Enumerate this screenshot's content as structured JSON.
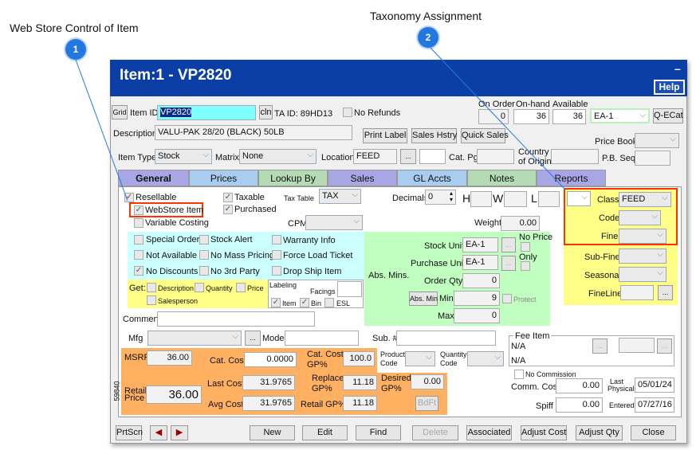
{
  "callouts": [
    {
      "number": "1",
      "text": "Web Store Control of Item"
    },
    {
      "number": "2",
      "text": "Taxonomy Assignment"
    }
  ],
  "window": {
    "title": "Item:1 - VP2820",
    "minimize": "–",
    "help": "Help"
  },
  "top": {
    "grid": "Grid",
    "item_id_label": "Item ID",
    "item_id": "VP2820",
    "cln": "cln",
    "ta_id": "TA ID: 89HD13",
    "no_refunds": "No Refunds",
    "on_order_label": "On Order",
    "on_order": "0",
    "on_hand_label": "On-hand",
    "on_hand": "36",
    "available_label": "Available",
    "available": "36",
    "unit": "EA-1",
    "qecat": "Q-ECat",
    "description_label": "Description",
    "description": "VALU-PAK 28/20 (BLACK) 50LB",
    "print_label": "Print Label",
    "sales_history": "Sales Hstry",
    "quick_sales": "Quick Sales",
    "price_book_label": "Price Book",
    "item_type_label": "Item Type",
    "item_type": "Stock",
    "matrix_label": "Matrix",
    "matrix": "None",
    "location_label": "Location",
    "location": "FEED",
    "more": "...",
    "cat_pg_label": "Cat. Pg.",
    "country_label_1": "Country",
    "country_label_2": "of Origin",
    "pb_seq_label": "P.B. Seq."
  },
  "tabs": [
    {
      "label": "General",
      "color": "#a9a6e6"
    },
    {
      "label": "Prices",
      "color": "#a8cdf0"
    },
    {
      "label": "Lookup By",
      "color": "#b5dbb5"
    },
    {
      "label": "Sales",
      "color": "#a9a6e6"
    },
    {
      "label": "GL Accts",
      "color": "#a8cdf0"
    },
    {
      "label": "Notes",
      "color": "#b5dbb5"
    },
    {
      "label": "Reports",
      "color": "#a9a6e6"
    }
  ],
  "general": {
    "resellable": "Resellable",
    "webstore": "WebStore Item",
    "variable_costing": "Variable Costing",
    "taxable": "Taxable",
    "purchased": "Purchased",
    "tax_table_label": "Tax Table",
    "tax_table": "TAX",
    "cpm_label": "CPM",
    "decimals_label": "Decimals",
    "decimals": "0",
    "h": "H",
    "w": "W",
    "l": "L",
    "weight_label": "Weight",
    "weight": "0.00",
    "flags": [
      [
        "Special Order",
        "Stock Alert",
        "Warranty Info"
      ],
      [
        "Not Available",
        "No Mass Pricing",
        "Force Load Ticket"
      ],
      [
        "No Discounts",
        "No 3rd Party",
        "Drop Ship Item"
      ]
    ],
    "get_label": "Get:",
    "get_description": "Description",
    "get_quantity": "Quantity",
    "get_price": "Price",
    "get_salesperson": "Salesperson",
    "labeling": "Labeling",
    "facings": "Facings",
    "label_item": "Item",
    "label_bin": "Bin",
    "label_esl": "ESL",
    "stock_unit_label": "Stock Unit",
    "stock_unit": "EA-1",
    "purchase_unit_label": "Purchase Unit",
    "purchase_unit": "EA-1",
    "no_price": "No Price",
    "only": "Only",
    "abs_mins": "Abs. Mins.",
    "order_qty_label": "Order Qty",
    "order_qty": "0",
    "abs_min_btn": "Abs. Min",
    "min_label": "Min",
    "min": "9",
    "protect": "Protect",
    "max_label": "Max",
    "max": "0",
    "class_label": "Class",
    "class": "FEED",
    "code_label": "Code",
    "fine_label": "Fine",
    "subfine_label": "Sub-Fine",
    "seasonal_label": "Seasonal",
    "fineline_label": "FineLine",
    "comment_label": "Comment",
    "mfg_label": "Mfg",
    "model_label": "Model",
    "sub_label": "Sub. #",
    "msrp_label": "MSRP",
    "msrp": "36.00",
    "cat_cost_label": "Cat. Cost",
    "cat_cost": "0.0000",
    "cat_cost_gp_label_1": "Cat. Cost",
    "cat_cost_gp_label_2": "GP%",
    "cat_cost_gp": "100.0",
    "product_code_1": "Product",
    "product_code_2": "Code",
    "quantity_code_1": "Quantity",
    "quantity_code_2": "Code",
    "retail_price_label_1": "Retail",
    "retail_price_label_2": "Price",
    "retail_price": "36.00",
    "last_cost_label": "Last Cost",
    "last_cost": "31.9765",
    "replace_gp_label_1": "Replace",
    "replace_gp_label_2": "GP%",
    "replace_gp": "11.18",
    "desired_gp_label_1": "Desired",
    "desired_gp_label_2": "GP%",
    "desired_gp": "0.00",
    "avg_cost_label": "Avg Cost",
    "avg_cost": "31.9765",
    "retail_gp_label": "Retail GP%",
    "retail_gp": "11.18",
    "bdft": "BdFt",
    "fee_item_label": "Fee Item",
    "fee_1": "N/A",
    "fee_2": "N/A",
    "no_commission": "No Commission",
    "comm_cost_label": "Comm. Cost",
    "comm_cost": "0.00",
    "last_physical_1": "Last",
    "last_physical_2": "Physical",
    "last_physical": "05/01/24",
    "spiff_label": "Spiff",
    "spiff": "0.00",
    "entered_label": "Entered",
    "entered": "07/27/16",
    "side_number": "59840"
  },
  "footer": {
    "prtscn": "PrtScn",
    "prev": "◀",
    "next": "▶",
    "new": "New",
    "edit": "Edit",
    "find": "Find",
    "delete": "Delete",
    "associated": "Associated",
    "adjust_cost": "Adjust Cost",
    "adjust_qty": "Adjust Qty",
    "close": "Close"
  }
}
